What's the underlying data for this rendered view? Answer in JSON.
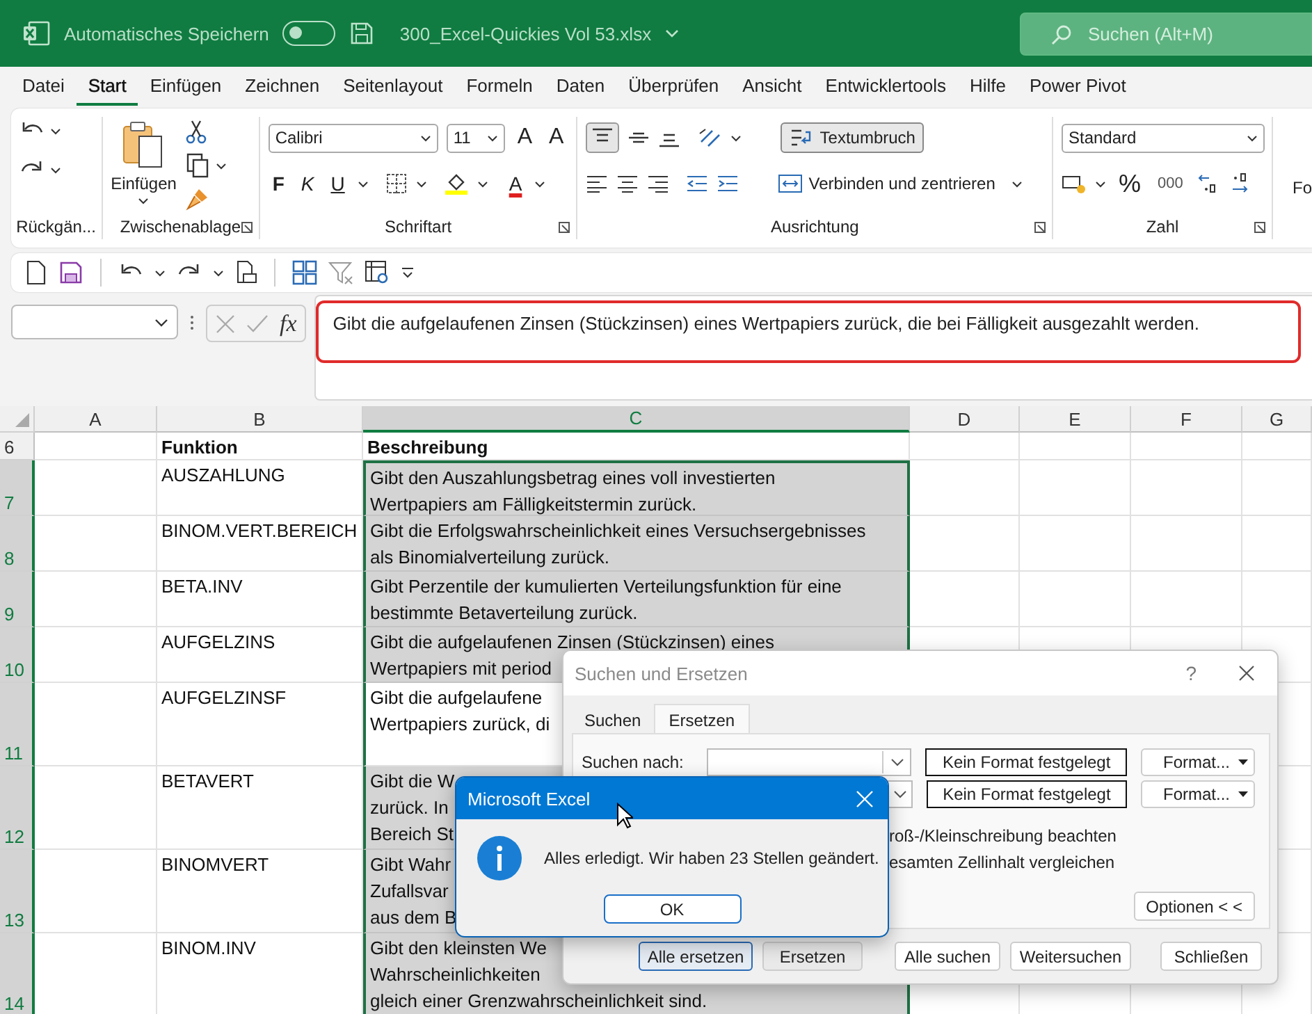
{
  "title_bar": {
    "autosave_label": "Automatisches Speichern",
    "autosave_on": false,
    "file_name": "300_Excel-Quickies Vol 53.xlsx",
    "search_placeholder": "Suchen (Alt+M)"
  },
  "menu_tabs": [
    {
      "label": "Datei",
      "selected": false
    },
    {
      "label": "Start",
      "selected": true
    },
    {
      "label": "Einfügen",
      "selected": false
    },
    {
      "label": "Zeichnen",
      "selected": false
    },
    {
      "label": "Seitenlayout",
      "selected": false
    },
    {
      "label": "Formeln",
      "selected": false
    },
    {
      "label": "Daten",
      "selected": false
    },
    {
      "label": "Überprüfen",
      "selected": false
    },
    {
      "label": "Ansicht",
      "selected": false
    },
    {
      "label": "Entwicklertools",
      "selected": false
    },
    {
      "label": "Hilfe",
      "selected": false
    },
    {
      "label": "Power Pivot",
      "selected": false
    }
  ],
  "ribbon": {
    "paste_label": "Einfügen",
    "font_name": "Calibri",
    "font_size": "11",
    "grow_font": "A",
    "shrink_font": "A",
    "bold": "F",
    "italic": "K",
    "underline": "U",
    "font_color": "A",
    "align_top_on": true,
    "wrap_text": "Textumbruch",
    "wrap_text_on": true,
    "merge_center": "Verbinden und zentrieren",
    "number_format": "Standard",
    "percent": "%",
    "thousands": "000",
    "cut_off_label": "Fo",
    "groups": [
      {
        "label": "Rückgän...",
        "launcher": false
      },
      {
        "label": "Zwischenablage",
        "launcher": true
      },
      {
        "label": "Schriftart",
        "launcher": true
      },
      {
        "label": "Ausrichtung",
        "launcher": true
      },
      {
        "label": "Zahl",
        "launcher": true
      }
    ]
  },
  "formula_bar": {
    "fx": "fx",
    "formula": "Gibt die aufgelaufenen Zinsen (Stückzinsen) eines Wertpapiers zurück, die bei Fälligkeit ausgezahlt werden."
  },
  "grid": {
    "columns": [
      {
        "label": "A",
        "selected": false
      },
      {
        "label": "B",
        "selected": false
      },
      {
        "label": "C",
        "selected": true
      },
      {
        "label": "D",
        "selected": false
      },
      {
        "label": "E",
        "selected": false
      },
      {
        "label": "F",
        "selected": false
      },
      {
        "label": "G",
        "selected": false
      }
    ],
    "header_row": {
      "number": "6",
      "function": "Funktion",
      "description": "Beschreibung"
    },
    "rows": [
      {
        "number": "7",
        "function": "AUSZAHLUNG",
        "description_lines": [
          "Gibt den Auszahlungsbetrag eines voll investierten",
          "Wertpapiers am Fälligkeitstermin zurück."
        ],
        "selected": true,
        "active": false
      },
      {
        "number": "8",
        "function": "BINOM.VERT.BEREICH",
        "description_lines": [
          "Gibt die Erfolgswahrscheinlichkeit eines Versuchsergebnisses",
          "als Binomialverteilung zurück."
        ],
        "selected": true,
        "active": false
      },
      {
        "number": "9",
        "function": "BETA.INV",
        "description_lines": [
          "Gibt Perzentile der kumulierten Verteilungsfunktion für eine",
          "bestimmte Betaverteilung zurück."
        ],
        "selected": true,
        "active": false
      },
      {
        "number": "10",
        "function": "AUFGELZINS",
        "description_lines": [
          "Gibt die aufgelaufenen Zinsen (Stückzinsen) eines",
          "Wertpapiers mit period"
        ],
        "selected": true,
        "active": false
      },
      {
        "number": "11",
        "function": "AUFGELZINSF",
        "description_lines": [
          "Gibt die aufgelaufene",
          "Wertpapiers zurück, di"
        ],
        "selected": true,
        "active": true
      },
      {
        "number": "12",
        "function": "BETAVERT",
        "description_lines": [
          "Gibt die W",
          "zurück. In",
          "Bereich St"
        ],
        "selected": true,
        "active": false
      },
      {
        "number": "13",
        "function": "BINOMVERT",
        "description_lines": [
          "Gibt Wahr",
          "Zufallsvar",
          "aus dem B"
        ],
        "selected": true,
        "active": false
      },
      {
        "number": "14",
        "function": "BINOM.INV",
        "description_lines": [
          "Gibt den kleinsten We",
          "Wahrscheinlichkeiten",
          "gleich einer Grenzwahrscheinlichkeit sind."
        ],
        "selected": true,
        "active": false
      }
    ]
  },
  "find_dialog": {
    "title": "Suchen und Ersetzen",
    "help": "?",
    "tabs": [
      {
        "label": "Suchen",
        "selected": false
      },
      {
        "label": "Ersetzen",
        "selected": true
      }
    ],
    "find_label": "Suchen nach:",
    "format_previews": [
      "Kein Format festgelegt",
      "Kein Format festgelegt"
    ],
    "format_buttons": [
      "Format...",
      "Format..."
    ],
    "options": [
      "roß-/Kleinschreibung beachten",
      "esamten Zellinhalt vergleichen"
    ],
    "options_button": "Optionen < <",
    "buttons": [
      {
        "label": "Alle ersetzen",
        "default": true
      },
      {
        "label": "Ersetzen",
        "default": false
      },
      {
        "label": "Alle suchen",
        "default": false
      },
      {
        "label": "Weitersuchen",
        "default": false
      },
      {
        "label": "Schließen",
        "default": false
      }
    ]
  },
  "message_box": {
    "title": "Microsoft Excel",
    "message": "Alles erledigt. Wir haben 23 Stellen geändert.",
    "button": "OK"
  }
}
